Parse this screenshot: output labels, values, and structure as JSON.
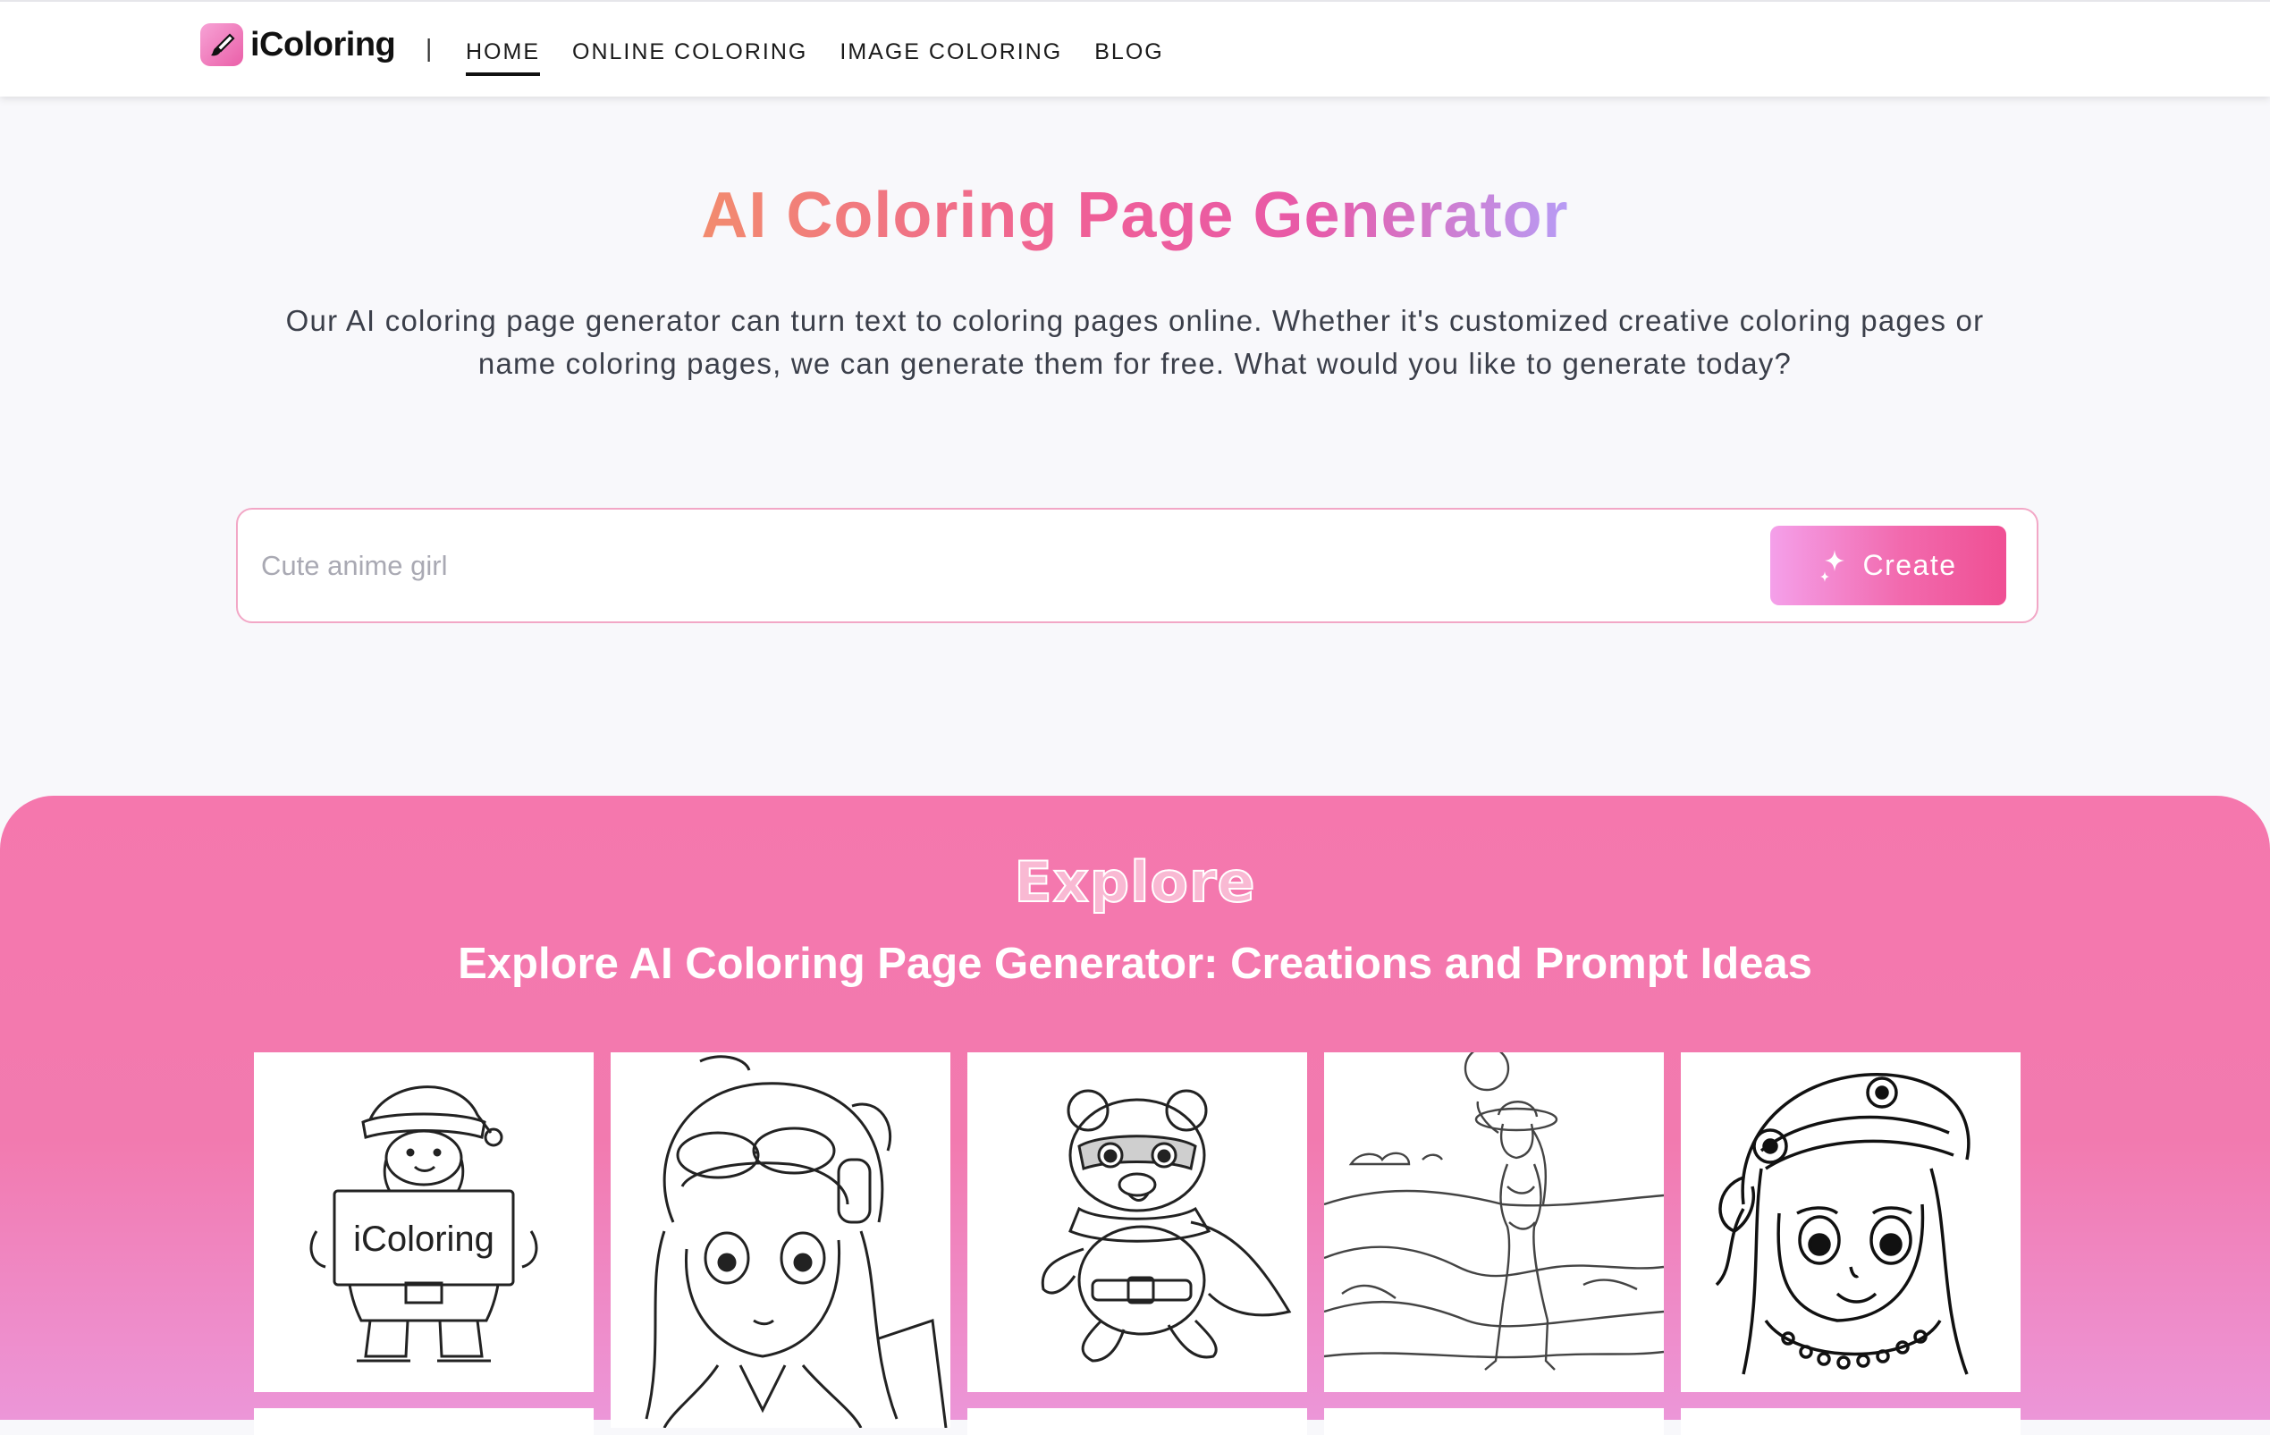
{
  "header": {
    "logo_text": "iColoring",
    "separator": "|",
    "nav": [
      {
        "label": "HOME",
        "active": true
      },
      {
        "label": "ONLINE COLORING",
        "active": false
      },
      {
        "label": "IMAGE COLORING",
        "active": false
      },
      {
        "label": "BLOG",
        "active": false
      }
    ]
  },
  "hero": {
    "title": "AI Coloring Page Generator",
    "description": "Our AI coloring page generator can turn text to coloring pages online. Whether it's customized creative coloring pages or name coloring pages, we can generate them for free. What would you like to generate today?",
    "search_placeholder": "Cute anime girl",
    "create_label": "Create"
  },
  "explore": {
    "badge": "Explore",
    "title": "Explore AI Coloring Page Generator: Creations and Prompt Ideas",
    "cards": [
      {
        "icon": "santa-sign-drawing",
        "sign_text": "iColoring"
      },
      {
        "icon": "anime-girl-headphones-drawing"
      },
      {
        "icon": "superhero-bear-drawing"
      },
      {
        "icon": "beach-woman-drawing"
      },
      {
        "icon": "girl-headscarf-drawing"
      }
    ]
  },
  "colors": {
    "accent_pink": "#f26aae",
    "explore_bg": "#f577ad",
    "title_gradient_start": "#f28b6e",
    "title_gradient_end": "#b79cf5"
  }
}
